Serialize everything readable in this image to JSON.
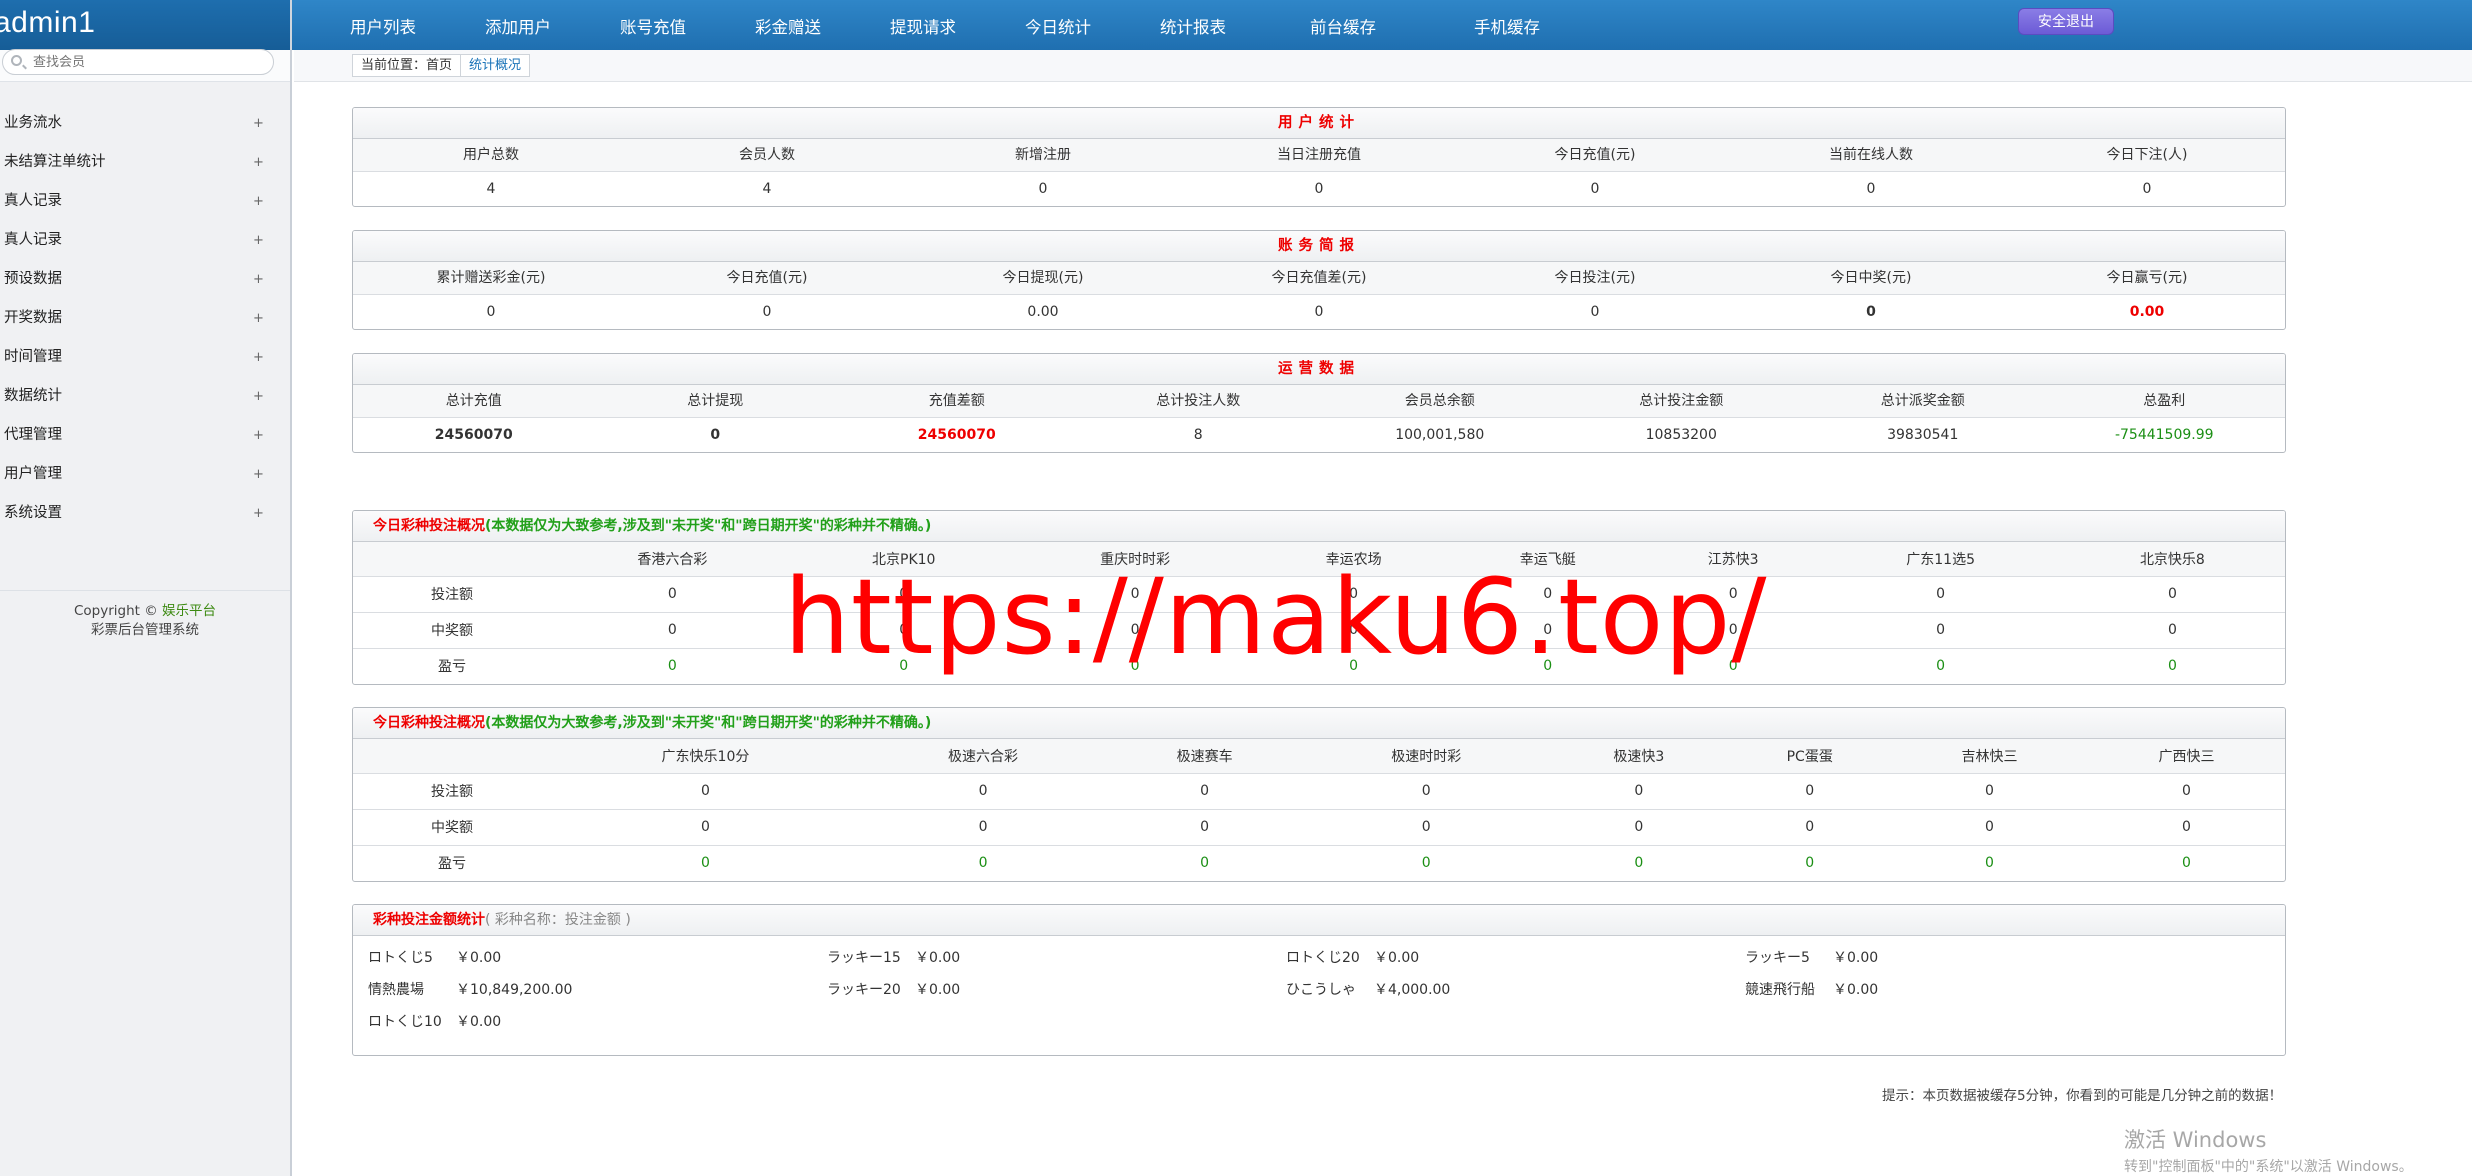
{
  "header": {
    "brand": "admin1",
    "nav": [
      "用户列表",
      "添加用户",
      "账号充值",
      "彩金赠送",
      "提现请求",
      "今日统计",
      "统计报表",
      "前台缓存",
      "手机缓存"
    ],
    "logout": "安全退出"
  },
  "sidebar": {
    "search_placeholder": "查找会员",
    "items": [
      "业务流水",
      "未结算注单统计",
      "真人记录",
      "真人记录",
      "预设数据",
      "开奖数据",
      "时间管理",
      "数据统计",
      "代理管理",
      "用户管理",
      "系统设置"
    ],
    "copyright_prefix": "Copyright ©",
    "copyright_brand": "娱乐平台",
    "copyright_sub": "彩票后台管理系统"
  },
  "breadcrumb": {
    "home": "当前位置：首页",
    "current": "统计概况"
  },
  "user_stats": {
    "title": "用户统计",
    "headers": [
      "用户总数",
      "会员人数",
      "新增注册",
      "当日注册充值",
      "今日充值(元)",
      "当前在线人数",
      "今日下注(人)"
    ],
    "values": [
      "4",
      "4",
      "0",
      "0",
      "0",
      "0",
      "0"
    ]
  },
  "finance": {
    "title": "账务简报",
    "headers": [
      "累计赠送彩金(元)",
      "今日充值(元)",
      "今日提现(元)",
      "今日充值差(元)",
      "今日投注(元)",
      "今日中奖(元)",
      "今日赢亏(元)"
    ],
    "values": [
      "0",
      "0",
      "0.00",
      "0",
      "0",
      "0",
      "0.00"
    ]
  },
  "operations": {
    "title": "运营数据",
    "headers": [
      "总计充值",
      "总计提现",
      "充值差额",
      "总计投注人数",
      "会员总余额",
      "总计投注金额",
      "总计派奖金额",
      "总盈利"
    ],
    "values": [
      "24560070",
      "0",
      "24560070",
      "8",
      "100,001,580",
      "10853200",
      "39830541",
      "-75441509.99"
    ]
  },
  "lottery_a": {
    "title": "今日彩种投注概况",
    "note": "(本数据仅为大致参考,涉及到\"未开奖\"和\"跨日期开奖\"的彩种并不精确。)",
    "columns": [
      "香港六合彩",
      "北京PK10",
      "重庆时时彩",
      "幸运农场",
      "幸运飞艇",
      "江苏快3",
      "广东11选5",
      "北京快乐8"
    ],
    "rows": [
      {
        "label": "投注额",
        "values": [
          "0",
          "0",
          "0",
          "0",
          "0",
          "0",
          "0",
          "0"
        ]
      },
      {
        "label": "中奖额",
        "values": [
          "0",
          "0",
          "0",
          "0",
          "0",
          "0",
          "0",
          "0"
        ]
      },
      {
        "label": "盈亏",
        "values": [
          "0",
          "0",
          "0",
          "0",
          "0",
          "0",
          "0",
          "0"
        ]
      }
    ]
  },
  "lottery_b": {
    "title": "今日彩种投注概况",
    "note": "(本数据仅为大致参考,涉及到\"未开奖\"和\"跨日期开奖\"的彩种并不精确。)",
    "columns": [
      "广东快乐10分",
      "极速六合彩",
      "极速赛车",
      "极速时时彩",
      "极速快3",
      "PC蛋蛋",
      "吉林快三",
      "广西快三"
    ],
    "rows": [
      {
        "label": "投注额",
        "values": [
          "0",
          "0",
          "0",
          "0",
          "0",
          "0",
          "0",
          "0"
        ]
      },
      {
        "label": "中奖额",
        "values": [
          "0",
          "0",
          "0",
          "0",
          "0",
          "0",
          "0",
          "0"
        ]
      },
      {
        "label": "盈亏",
        "values": [
          "0",
          "0",
          "0",
          "0",
          "0",
          "0",
          "0",
          "0"
        ]
      }
    ]
  },
  "amounts": {
    "title": "彩种投注金额统计",
    "subtitle": "( 彩种名称：投注金额 )",
    "items": [
      {
        "name": "ロトくじ5",
        "value": "￥0.00"
      },
      {
        "name": "ラッキー15",
        "value": "￥0.00"
      },
      {
        "name": "ロトくじ20",
        "value": "￥0.00"
      },
      {
        "name": "ラッキー5",
        "value": "￥0.00"
      },
      {
        "name": "情熱農場",
        "value": "￥10,849,200.00"
      },
      {
        "name": "ラッキー20",
        "value": "￥0.00"
      },
      {
        "name": "ひこうしゃ",
        "value": "￥4,000.00"
      },
      {
        "name": "競速飛行船",
        "value": "￥0.00"
      },
      {
        "name": "ロトくじ10",
        "value": "￥0.00"
      }
    ]
  },
  "tip": "提示：本页数据被缓存5分钟，你看到的可能是几分钟之前的数据！",
  "watermark": "https://maku6.top/",
  "activation": {
    "title": "激活 Windows",
    "subtitle": "转到\"控制面板\"中的\"系统\"以激活 Windows。"
  },
  "colors": {
    "topbar": "#2f86c8",
    "logout": "#7b6ddf",
    "warn": "#e00000",
    "ok": "#1b8f14"
  }
}
